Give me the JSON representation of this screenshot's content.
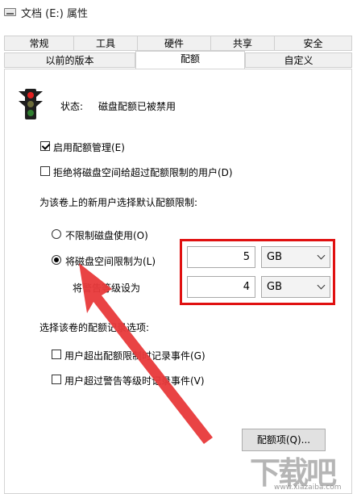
{
  "window": {
    "title": "文档 (E:) 属性"
  },
  "tabs_row1": [
    {
      "label": "常规"
    },
    {
      "label": "工具"
    },
    {
      "label": "硬件"
    },
    {
      "label": "共享"
    },
    {
      "label": "安全"
    }
  ],
  "tabs_row2": [
    {
      "label": "以前的版本"
    },
    {
      "label": "配额"
    },
    {
      "label": "自定义"
    }
  ],
  "status": {
    "label": "状态:",
    "value": "磁盘配额已被禁用"
  },
  "options": {
    "enable_quota": {
      "label": "启用配额管理(E)",
      "checked": true
    },
    "deny_space": {
      "label": "拒绝将磁盘空间给超过配额限制的用户(D)",
      "checked": false
    }
  },
  "defaults": {
    "heading": "为该卷上的新用户选择默认配额限制:",
    "no_limit": {
      "label": "不限制磁盘使用(O)",
      "selected": false
    },
    "limit_to": {
      "label": "将磁盘空间限制为(L)",
      "selected": true,
      "value": "5",
      "unit": "GB"
    },
    "warning": {
      "label": "将警告等级设为",
      "value": "4",
      "unit": "GB"
    }
  },
  "logging": {
    "heading": "选择该卷的配额记录选项:",
    "over_limit": {
      "label": "用户超出配额限制时记录事件(G)",
      "checked": false
    },
    "over_warning": {
      "label": "用户超过警告等级时记录事件(V)",
      "checked": false
    }
  },
  "buttons": {
    "quota_entries": "配额项(Q)..."
  },
  "watermark": {
    "main": "下载吧",
    "sub": "www.xiazaiba.com"
  },
  "colors": {
    "highlight": "#e01010",
    "arrow": "#e8393a"
  }
}
